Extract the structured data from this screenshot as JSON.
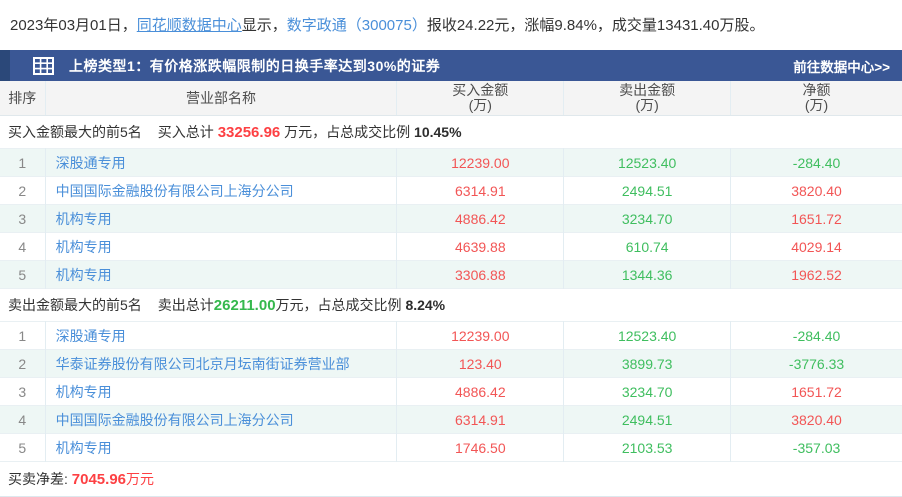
{
  "intro": {
    "prefix": "2023年03月01日，",
    "datacenter_link": "同花顺数据中心",
    "mid": "显示，",
    "stock_link": "数字政通（300075）",
    "suffix": "报收24.22元，涨幅9.84%，成交量13431.40万股。"
  },
  "panel": {
    "title": "上榜类型1：有价格涨跌幅限制的日换手率达到30%的证券",
    "goto_link": "前往数据中心>>",
    "grid_icon": "table-grid-icon"
  },
  "table": {
    "headers": [
      {
        "t": "排序",
        "u": ""
      },
      {
        "t": "营业部名称",
        "u": ""
      },
      {
        "t": "买入金额",
        "u": "(万)"
      },
      {
        "t": "卖出金额",
        "u": "(万)"
      },
      {
        "t": "净额",
        "u": "(万)"
      }
    ]
  },
  "buy_section": {
    "label": "买入金额最大的前5名",
    "total_prefix": "买入总计 ",
    "total_value": "33256.96",
    "total_color": "red",
    "total_unit": " 万元，",
    "ratio_label": "占总成交比例 ",
    "ratio_value": "10.45%",
    "rows": [
      {
        "rank": "1",
        "name": "深股通专用",
        "buy": "12239.00",
        "sell": "12523.40",
        "net": "-284.40",
        "net_color": "green",
        "shaded": true
      },
      {
        "rank": "2",
        "name": "中国国际金融股份有限公司上海分公司",
        "buy": "6314.91",
        "sell": "2494.51",
        "net": "3820.40",
        "net_color": "red",
        "shaded": false
      },
      {
        "rank": "3",
        "name": "机构专用",
        "buy": "4886.42",
        "sell": "3234.70",
        "net": "1651.72",
        "net_color": "red",
        "shaded": true
      },
      {
        "rank": "4",
        "name": "机构专用",
        "buy": "4639.88",
        "sell": "610.74",
        "net": "4029.14",
        "net_color": "red",
        "shaded": false
      },
      {
        "rank": "5",
        "name": "机构专用",
        "buy": "3306.88",
        "sell": "1344.36",
        "net": "1962.52",
        "net_color": "red",
        "shaded": true
      }
    ]
  },
  "sell_section": {
    "label": "卖出金额最大的前5名",
    "total_prefix": "卖出总计",
    "total_value": "26211.00",
    "total_color": "green",
    "total_unit": "万元，",
    "ratio_label": "占总成交比例 ",
    "ratio_value": "8.24%",
    "rows": [
      {
        "rank": "1",
        "name": "深股通专用",
        "buy": "12239.00",
        "sell": "12523.40",
        "net": "-284.40",
        "net_color": "green",
        "shaded": false
      },
      {
        "rank": "2",
        "name": "华泰证券股份有限公司北京月坛南街证券营业部",
        "buy": "123.40",
        "sell": "3899.73",
        "net": "-3776.33",
        "net_color": "green",
        "shaded": true
      },
      {
        "rank": "3",
        "name": "机构专用",
        "buy": "4886.42",
        "sell": "3234.70",
        "net": "1651.72",
        "net_color": "red",
        "shaded": false
      },
      {
        "rank": "4",
        "name": "中国国际金融股份有限公司上海分公司",
        "buy": "6314.91",
        "sell": "2494.51",
        "net": "3820.40",
        "net_color": "red",
        "shaded": true
      },
      {
        "rank": "5",
        "name": "机构专用",
        "buy": "1746.50",
        "sell": "2103.53",
        "net": "-357.03",
        "net_color": "green",
        "shaded": false
      }
    ]
  },
  "footer": {
    "label": "买卖净差: ",
    "value": "7045.96",
    "unit": "万元"
  },
  "colors": {
    "bar_blue": "#3a5795",
    "bar_accent_blue": "#2b4879",
    "link_blue": "#4a8fd9",
    "buy_red": "#f25555",
    "bold_red": "#fd4043",
    "sell_green": "#3fbe5f",
    "shaded_row": "#eef7f5"
  }
}
